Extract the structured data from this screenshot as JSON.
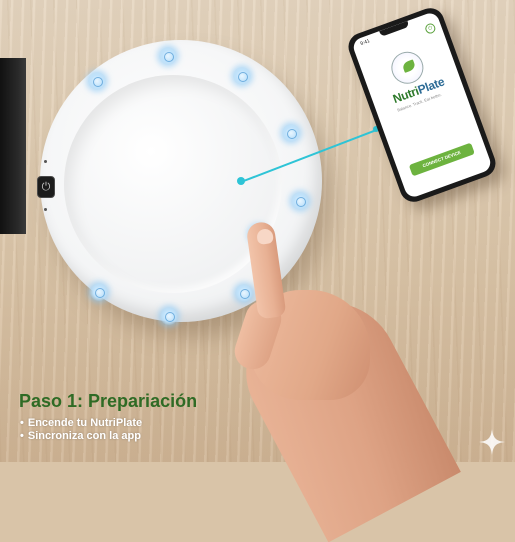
{
  "phone": {
    "status_time": "9:41",
    "app_name_part1": "Nutri",
    "app_name_part2": "Plate",
    "tagline": "Balance. Track. Eat better.",
    "connect_label": "CONNECT DEVICE",
    "back_icon": "power-icon"
  },
  "plate": {
    "power_icon": "power-icon",
    "power_glyph": "⏻"
  },
  "caption": {
    "title": "Paso 1: Prepariación",
    "steps": [
      "Encende tu NutriPlate",
      "Sincroniza con la app"
    ]
  },
  "colors": {
    "caption_title": "#2f6b25",
    "accent_line": "#2ec4d6",
    "app_green": "#6db33f",
    "touch_glow": "#bfe2fb"
  },
  "icons": [
    "power-icon",
    "touch-sensor-icon",
    "sparkle-icon"
  ]
}
